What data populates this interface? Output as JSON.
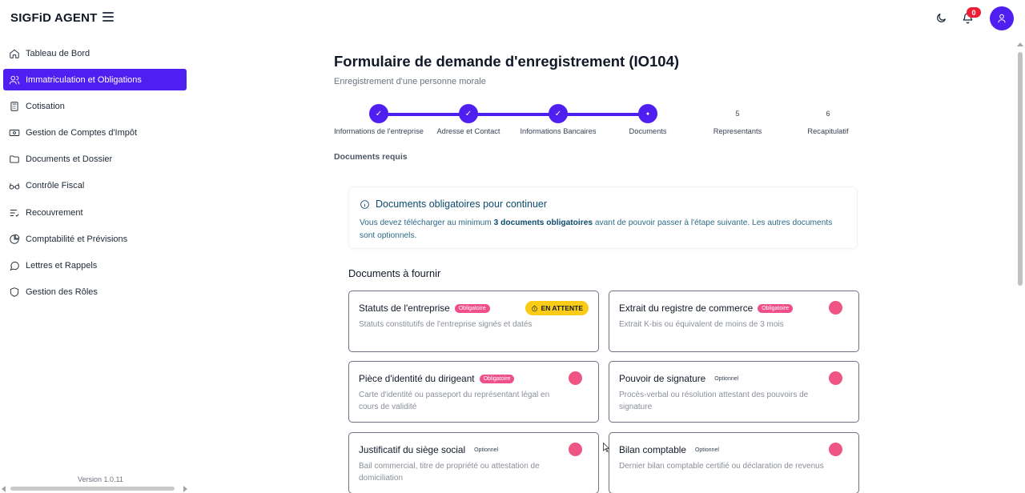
{
  "app": {
    "brand": "SIGFiD AGENT",
    "version": "Version 1.0.11",
    "accent": "#4f1ef0"
  },
  "sidebar": {
    "items": [
      {
        "label": "Tableau de Bord",
        "icon": "home-icon"
      },
      {
        "label": "Immatriculation et Obligations",
        "icon": "users-icon",
        "active": true
      },
      {
        "label": "Cotisation",
        "icon": "calculator-icon"
      },
      {
        "label": "Gestion de Comptes d'Impôt",
        "icon": "wallet-icon"
      },
      {
        "label": "Documents et Dossier",
        "icon": "folder-icon"
      },
      {
        "label": "Contrôle Fiscal",
        "icon": "glasses-icon"
      },
      {
        "label": "Recouvrement",
        "icon": "list-check-icon"
      },
      {
        "label": "Comptabilité et Prévisions",
        "icon": "pie-chart-icon"
      },
      {
        "label": "Lettres et Rappels",
        "icon": "message-icon"
      },
      {
        "label": "Gestion des Rôles",
        "icon": "shield-icon"
      }
    ]
  },
  "header": {
    "notification_count": "0"
  },
  "page": {
    "title": "Formulaire de demande d'enregistrement (IO104)",
    "subtitle": "Enregistrement d'une personne morale",
    "docs_required_label": "Documents requis",
    "section_title": "Documents à fournir"
  },
  "stepper": {
    "steps": [
      {
        "label": "Informations de l'entreprise",
        "state": "done",
        "marker": "✓"
      },
      {
        "label": "Adresse et Contact",
        "state": "done",
        "marker": "✓"
      },
      {
        "label": "Informations Bancaires",
        "state": "done",
        "marker": "✓"
      },
      {
        "label": "Documents",
        "state": "current",
        "marker": "●"
      },
      {
        "label": "Representants",
        "state": "pending",
        "marker": "5"
      },
      {
        "label": "Recapitulatif",
        "state": "pending",
        "marker": "6"
      }
    ]
  },
  "info": {
    "title": "Documents obligatoires pour continuer",
    "text_before": "Vous devez télécharger au minimum ",
    "text_bold": "3 documents obligatoires",
    "text_after": " avant de pouvoir passer à l'étape suivante. Les autres documents sont optionnels."
  },
  "documents": [
    {
      "title": "Statuts de l'entreprise",
      "tag": "Obligatoire",
      "required": true,
      "desc": "Statuts constitutifs de l'entreprise signés et datés",
      "status": "EN ATTENTE"
    },
    {
      "title": "Extrait du registre de commerce",
      "tag": "Obligatoire",
      "required": true,
      "desc": "Extrait K-bis ou équivalent de moins de 3 mois"
    },
    {
      "title": "Pièce d'identité du dirigeant",
      "tag": "Obligatoire",
      "required": true,
      "desc": "Carte d'identité ou passeport du représentant légal en cours de validité"
    },
    {
      "title": "Pouvoir de signature",
      "tag": "Optionnel",
      "required": false,
      "desc": "Procès-verbal ou résolution attestant des pouvoirs de signature"
    },
    {
      "title": "Justificatif du siège social",
      "tag": "Optionnel",
      "required": false,
      "desc": "Bail commercial, titre de propriété ou attestation de domiciliation"
    },
    {
      "title": "Bilan comptable",
      "tag": "Optionnel",
      "required": false,
      "desc": "Dernier bilan comptable certifié ou déclaration de revenus"
    }
  ]
}
